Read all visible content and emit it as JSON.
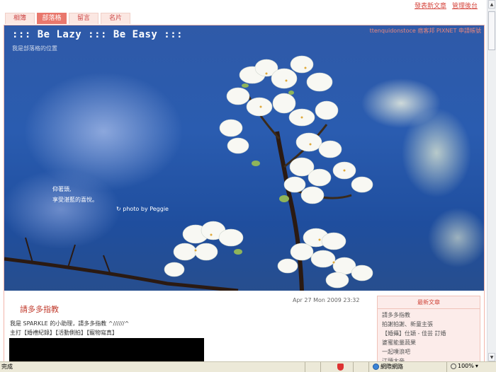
{
  "top_links": [
    "發表新文章",
    "管理後台"
  ],
  "tabs": [
    {
      "label": "相簿",
      "active": false
    },
    {
      "label": "部落格",
      "active": true
    },
    {
      "label": "留言",
      "active": false
    },
    {
      "label": "名片",
      "active": false
    }
  ],
  "header": {
    "title": "::: Be Lazy ::: Be Easy :::",
    "subtitle": "我是部落格的位置",
    "links": "ttenquidonstoce 痞客邦 PIXNET 申請帳號"
  },
  "hero": {
    "quote_line1": "仰著頭,",
    "quote_line2": "享受湛藍的喜悅。",
    "credit": "↻ photo by Peggie"
  },
  "post": {
    "date": "Apr 27 Mon 2009 23:32",
    "title": "請多多指教",
    "line1": "我是 SPARKLE 的小助理，請多多指教 ^//////^",
    "line2": "主打【婚禮紀錄】【活動側拍】【寵物寫真】"
  },
  "sidebar": {
    "title": "最新文章",
    "items": [
      "請多多指教",
      "拍謝拍謝、新童主張",
      "【婚攝】仕穎 - 佳芸 訂婚",
      "婆蜜能量蔬果",
      "一起噗浪吧",
      "江頭大帝"
    ]
  },
  "statusbar": {
    "status": "完成",
    "zone": "網際網路",
    "zoom": "100%"
  },
  "colors": {
    "accent": "#e9776c",
    "link": "#d5463e",
    "sky": "#2a5cb0"
  }
}
